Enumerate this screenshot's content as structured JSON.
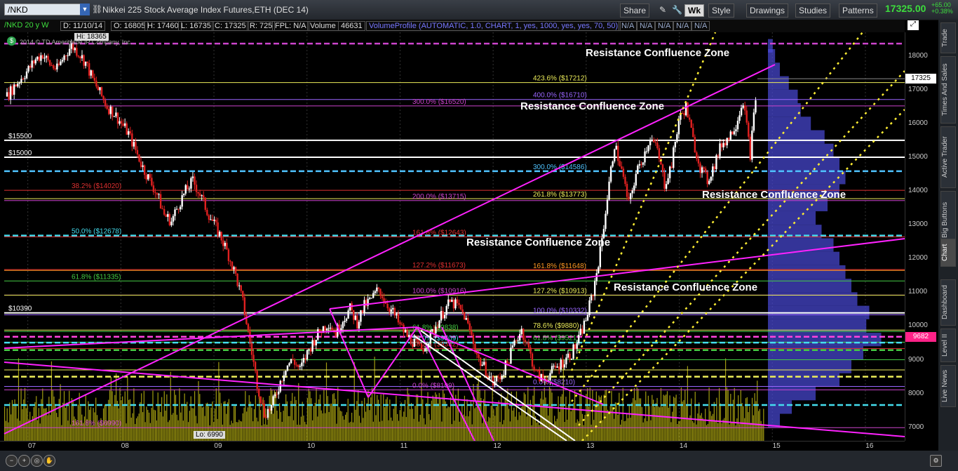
{
  "toolbar": {
    "symbol": "/NKD",
    "description": "Nikkei 225 Stock Average Index Futures,ETH (DEC 14)",
    "share": "Share",
    "wk": "Wk",
    "style": "Style",
    "drawings": "Drawings",
    "studies": "Studies",
    "patterns": "Patterns",
    "last_price": "17325.00",
    "change_abs": "+65.00",
    "change_pct": "+0.38%"
  },
  "infobar": {
    "aggregation": "/NKD 20 y W",
    "date": "D: 11/10/14",
    "open": "O: 16805",
    "high": "H: 17460",
    "low": "L: 16735",
    "close": "C: 17325",
    "range": "R: 725",
    "fpl": "FPL: N/A",
    "volume_label": "Volume",
    "volume_value": "46631",
    "volume_profile": "VolumeProfile (AUTOMATIC, 1.0, CHART, 1, yes, 1000, yes, yes, 70, 50)",
    "na": [
      "N/A",
      "N/A",
      "N/A",
      "N/A",
      "N/A"
    ]
  },
  "chart_data": {
    "type": "candlestick",
    "copyright": "2014 © TD Ameritrade IP Company, Inc.",
    "hi_label": "Hi: 18365",
    "lo_label": "Lo: 6990",
    "ylim": [
      6600,
      18700
    ],
    "y_ticks": [
      7000,
      8000,
      9000,
      10000,
      11000,
      12000,
      13000,
      14000,
      15000,
      16000,
      17000,
      18000
    ],
    "x_ticks": [
      "07",
      "08",
      "09",
      "10",
      "11",
      "12",
      "13",
      "14",
      "15",
      "16"
    ],
    "price_marker": 17325,
    "poc_marker": 9682,
    "closes": [
      16800,
      17100,
      17350,
      17600,
      17900,
      18050,
      17750,
      17600,
      18000,
      18300,
      18100,
      17800,
      17300,
      16900,
      16500,
      16300,
      16000,
      15700,
      15200,
      14700,
      14300,
      13900,
      13300,
      13100,
      13600,
      14000,
      14300,
      13900,
      13400,
      13000,
      12600,
      12100,
      11500,
      10700,
      9500,
      8300,
      7400,
      7600,
      8200,
      8800,
      9000,
      8700,
      9200,
      9600,
      9900,
      10100,
      9800,
      10200,
      10500,
      10100,
      10600,
      10800,
      11100,
      10700,
      10400,
      10000,
      9700,
      9500,
      9300,
      9600,
      10000,
      10400,
      10700,
      10600,
      10300,
      9700,
      9000,
      8700,
      8300,
      8500,
      8900,
      9500,
      9900,
      9300,
      8600,
      8400,
      8600,
      8800,
      9000,
      9200,
      9600,
      10200,
      11000,
      12200,
      13800,
      15400,
      14600,
      13600,
      14500,
      15000,
      15600,
      15200,
      14200,
      14800,
      16100,
      16500,
      15500,
      14700,
      14300,
      14800,
      15400,
      15600,
      16000,
      16700,
      15100,
      17325
    ],
    "volume_max": 100,
    "horizontal_levels": [
      {
        "price": 18365,
        "label": "",
        "color": "#cc44cc",
        "style": "dash"
      },
      {
        "price": 17212,
        "label": "423.6% ($17212)",
        "color": "#eded5a",
        "style": "solid"
      },
      {
        "price": 16710,
        "label": "400.0% ($16710)",
        "color": "#9a66ff",
        "style": "solid"
      },
      {
        "price": 16520,
        "label": "300.0% ($16520)",
        "color": "#cc44cc",
        "style": "solid"
      },
      {
        "price": 15500,
        "label": "$15500",
        "color": "#ffffff",
        "style": "solid"
      },
      {
        "price": 15000,
        "label": "$15000",
        "color": "#ffffff",
        "style": "solid"
      },
      {
        "price": 14586,
        "label": "300.0% ($14586)",
        "color": "#4fc3ff",
        "style": "dash"
      },
      {
        "price": 14020,
        "label": "38.2% ($14020)",
        "color": "#e03030",
        "style": "solid"
      },
      {
        "price": 13773,
        "label": "261.8% ($13773)",
        "color": "#eded5a",
        "style": "solid"
      },
      {
        "price": 13715,
        "label": "200.0% ($13715)",
        "color": "#cc44cc",
        "style": "solid"
      },
      {
        "price": 12678,
        "label": "50.0% ($12678)",
        "color": "#44ddee",
        "style": "dash"
      },
      {
        "price": 12643,
        "label": "161.8% ($12643)",
        "color": "#e03030",
        "style": "solid"
      },
      {
        "price": 11673,
        "label": "127.2% ($11673)",
        "color": "#e03030",
        "style": "solid"
      },
      {
        "price": 11648,
        "label": "161.8% ($11648)",
        "color": "#ff9922",
        "style": "solid"
      },
      {
        "price": 11335,
        "label": "61.8% ($11335)",
        "color": "#44cc44",
        "style": "solid"
      },
      {
        "price": 10916,
        "label": "100.0% ($10916)",
        "color": "#cc44cc",
        "style": "solid"
      },
      {
        "price": 10913,
        "label": "127.2% ($10913)",
        "color": "#eded5a",
        "style": "solid"
      },
      {
        "price": 10390,
        "label": "$10390",
        "color": "#ffffff",
        "style": "solid"
      },
      {
        "price": 10332,
        "label": "100.0% ($10332)",
        "color": "#9a66ff",
        "style": "solid"
      },
      {
        "price": 9880,
        "label": "78.6% ($9880)",
        "color": "#eded5a",
        "style": "solid"
      },
      {
        "price": 9838,
        "label": "61.8% ($9838)",
        "color": "#44cc44",
        "style": "solid"
      },
      {
        "price": 9682,
        "label": "",
        "color": "#ff44dd",
        "style": "dash"
      },
      {
        "price": 9521,
        "label": "61.8% ($9521)",
        "color": "#44cc44",
        "style": "solid"
      },
      {
        "price": 9509,
        "label": "50.0% ($9509)",
        "color": "#44ddee",
        "style": "dash"
      },
      {
        "price": 9332,
        "label": "38.2% ($9332)",
        "color": "#e03030",
        "style": "solid"
      },
      {
        "price": 9288,
        "label": "",
        "color": "#44cc44",
        "style": "dash"
      },
      {
        "price": 9000,
        "label": "",
        "color": "#44cc44",
        "style": "solid"
      },
      {
        "price": 8700,
        "label": "",
        "color": "#eded5a",
        "style": "solid"
      },
      {
        "price": 8500,
        "label": "",
        "color": "#eded5a",
        "style": "dash"
      },
      {
        "price": 8109,
        "label": "0.0% ($8109)",
        "color": "#cc44cc",
        "style": "solid"
      },
      {
        "price": 8210,
        "label": "0.0% ($8210)",
        "color": "#9a66ff",
        "style": "solid"
      },
      {
        "price": 7660,
        "label": "",
        "color": "#44ddee",
        "style": "dash"
      },
      {
        "price": 6990,
        "label": "161.8% ($6990)",
        "color": "#cc44cc",
        "style": "solid"
      }
    ],
    "zone_labels": [
      "Resistance Confluence Zone",
      "Resistance Confluence Zone",
      "Resistance Confluence Zone",
      "Resistance Confluence Zone",
      "Resistance Confluence Zone"
    ]
  },
  "right_tabs": [
    "Trade",
    "Times And Sales",
    "Active Trader",
    "Big Buttons",
    "Chart",
    "Dashboard",
    "Level II",
    "Live News"
  ],
  "colors": {
    "up": "#ffffff",
    "down": "#e02020",
    "volume": "#a09a10",
    "profile": "#4a4ad8",
    "magenta": "#ff22ff",
    "price_green": "#3ddc3d"
  }
}
